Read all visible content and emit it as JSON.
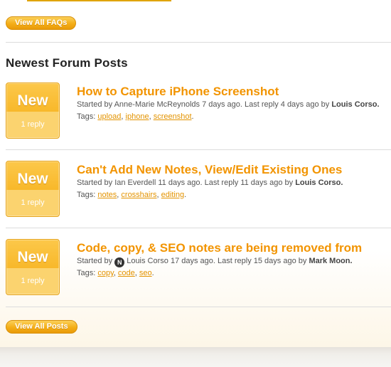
{
  "faq": {
    "view_all_label": "View All FAQs"
  },
  "section": {
    "title": "Newest Forum Posts"
  },
  "posts": [
    {
      "badge": "New",
      "replies": "1 reply",
      "title": "How to Capture iPhone Screenshot",
      "started_prefix": "Started by ",
      "author": "Anne-Marie McReynolds",
      "started_ago": " 7 days ago. Last reply 4 days ago by ",
      "last_reply_by": "Louis Corso.",
      "tags_label": "Tags: ",
      "tags": [
        "upload",
        "iphone",
        "screenshot"
      ]
    },
    {
      "badge": "New",
      "replies": "1 reply",
      "title": "Can't Add New Notes, View/Edit Existing Ones",
      "started_prefix": "Started by ",
      "author": "Ian Everdell",
      "started_ago": " 11 days ago. Last reply 11 days ago by ",
      "last_reply_by": "Louis Corso.",
      "tags_label": "Tags: ",
      "tags": [
        "notes",
        "crosshairs",
        "editing"
      ]
    },
    {
      "badge": "New",
      "replies": "1 reply",
      "title": "Code, copy, & SEO notes are being removed from",
      "started_prefix": "Started by ",
      "avatar_letter": "N",
      "author": "Louis Corso",
      "started_ago": " 17 days ago. Last reply 15 days ago by ",
      "last_reply_by": "Mark Moon.",
      "tags_label": "Tags: ",
      "tags": [
        "copy",
        "code",
        "seo"
      ]
    }
  ],
  "posts_footer": {
    "view_all_label": "View All Posts"
  },
  "colors": {
    "accent": "#f29400",
    "link": "#e39300",
    "badge": "#f8b82a"
  }
}
